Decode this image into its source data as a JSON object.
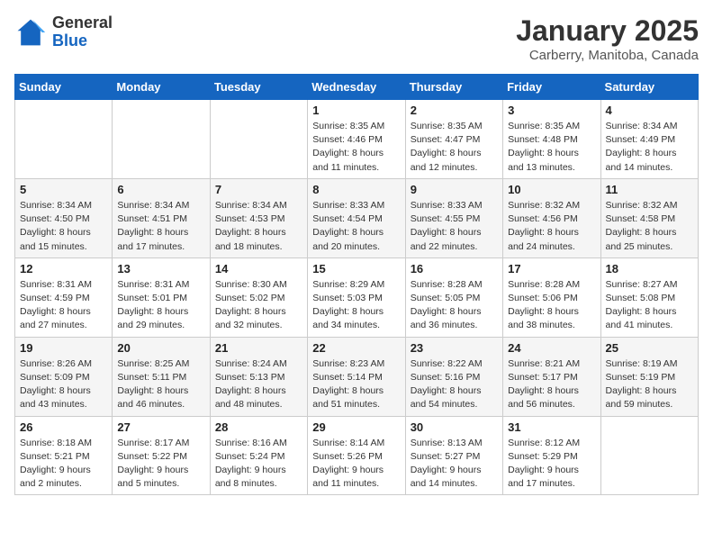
{
  "header": {
    "logo_line1": "General",
    "logo_line2": "Blue",
    "month": "January 2025",
    "location": "Carberry, Manitoba, Canada"
  },
  "weekdays": [
    "Sunday",
    "Monday",
    "Tuesday",
    "Wednesday",
    "Thursday",
    "Friday",
    "Saturday"
  ],
  "weeks": [
    [
      {
        "day": "",
        "info": ""
      },
      {
        "day": "",
        "info": ""
      },
      {
        "day": "",
        "info": ""
      },
      {
        "day": "1",
        "info": "Sunrise: 8:35 AM\nSunset: 4:46 PM\nDaylight: 8 hours\nand 11 minutes."
      },
      {
        "day": "2",
        "info": "Sunrise: 8:35 AM\nSunset: 4:47 PM\nDaylight: 8 hours\nand 12 minutes."
      },
      {
        "day": "3",
        "info": "Sunrise: 8:35 AM\nSunset: 4:48 PM\nDaylight: 8 hours\nand 13 minutes."
      },
      {
        "day": "4",
        "info": "Sunrise: 8:34 AM\nSunset: 4:49 PM\nDaylight: 8 hours\nand 14 minutes."
      }
    ],
    [
      {
        "day": "5",
        "info": "Sunrise: 8:34 AM\nSunset: 4:50 PM\nDaylight: 8 hours\nand 15 minutes."
      },
      {
        "day": "6",
        "info": "Sunrise: 8:34 AM\nSunset: 4:51 PM\nDaylight: 8 hours\nand 17 minutes."
      },
      {
        "day": "7",
        "info": "Sunrise: 8:34 AM\nSunset: 4:53 PM\nDaylight: 8 hours\nand 18 minutes."
      },
      {
        "day": "8",
        "info": "Sunrise: 8:33 AM\nSunset: 4:54 PM\nDaylight: 8 hours\nand 20 minutes."
      },
      {
        "day": "9",
        "info": "Sunrise: 8:33 AM\nSunset: 4:55 PM\nDaylight: 8 hours\nand 22 minutes."
      },
      {
        "day": "10",
        "info": "Sunrise: 8:32 AM\nSunset: 4:56 PM\nDaylight: 8 hours\nand 24 minutes."
      },
      {
        "day": "11",
        "info": "Sunrise: 8:32 AM\nSunset: 4:58 PM\nDaylight: 8 hours\nand 25 minutes."
      }
    ],
    [
      {
        "day": "12",
        "info": "Sunrise: 8:31 AM\nSunset: 4:59 PM\nDaylight: 8 hours\nand 27 minutes."
      },
      {
        "day": "13",
        "info": "Sunrise: 8:31 AM\nSunset: 5:01 PM\nDaylight: 8 hours\nand 29 minutes."
      },
      {
        "day": "14",
        "info": "Sunrise: 8:30 AM\nSunset: 5:02 PM\nDaylight: 8 hours\nand 32 minutes."
      },
      {
        "day": "15",
        "info": "Sunrise: 8:29 AM\nSunset: 5:03 PM\nDaylight: 8 hours\nand 34 minutes."
      },
      {
        "day": "16",
        "info": "Sunrise: 8:28 AM\nSunset: 5:05 PM\nDaylight: 8 hours\nand 36 minutes."
      },
      {
        "day": "17",
        "info": "Sunrise: 8:28 AM\nSunset: 5:06 PM\nDaylight: 8 hours\nand 38 minutes."
      },
      {
        "day": "18",
        "info": "Sunrise: 8:27 AM\nSunset: 5:08 PM\nDaylight: 8 hours\nand 41 minutes."
      }
    ],
    [
      {
        "day": "19",
        "info": "Sunrise: 8:26 AM\nSunset: 5:09 PM\nDaylight: 8 hours\nand 43 minutes."
      },
      {
        "day": "20",
        "info": "Sunrise: 8:25 AM\nSunset: 5:11 PM\nDaylight: 8 hours\nand 46 minutes."
      },
      {
        "day": "21",
        "info": "Sunrise: 8:24 AM\nSunset: 5:13 PM\nDaylight: 8 hours\nand 48 minutes."
      },
      {
        "day": "22",
        "info": "Sunrise: 8:23 AM\nSunset: 5:14 PM\nDaylight: 8 hours\nand 51 minutes."
      },
      {
        "day": "23",
        "info": "Sunrise: 8:22 AM\nSunset: 5:16 PM\nDaylight: 8 hours\nand 54 minutes."
      },
      {
        "day": "24",
        "info": "Sunrise: 8:21 AM\nSunset: 5:17 PM\nDaylight: 8 hours\nand 56 minutes."
      },
      {
        "day": "25",
        "info": "Sunrise: 8:19 AM\nSunset: 5:19 PM\nDaylight: 8 hours\nand 59 minutes."
      }
    ],
    [
      {
        "day": "26",
        "info": "Sunrise: 8:18 AM\nSunset: 5:21 PM\nDaylight: 9 hours\nand 2 minutes."
      },
      {
        "day": "27",
        "info": "Sunrise: 8:17 AM\nSunset: 5:22 PM\nDaylight: 9 hours\nand 5 minutes."
      },
      {
        "day": "28",
        "info": "Sunrise: 8:16 AM\nSunset: 5:24 PM\nDaylight: 9 hours\nand 8 minutes."
      },
      {
        "day": "29",
        "info": "Sunrise: 8:14 AM\nSunset: 5:26 PM\nDaylight: 9 hours\nand 11 minutes."
      },
      {
        "day": "30",
        "info": "Sunrise: 8:13 AM\nSunset: 5:27 PM\nDaylight: 9 hours\nand 14 minutes."
      },
      {
        "day": "31",
        "info": "Sunrise: 8:12 AM\nSunset: 5:29 PM\nDaylight: 9 hours\nand 17 minutes."
      },
      {
        "day": "",
        "info": ""
      }
    ]
  ]
}
